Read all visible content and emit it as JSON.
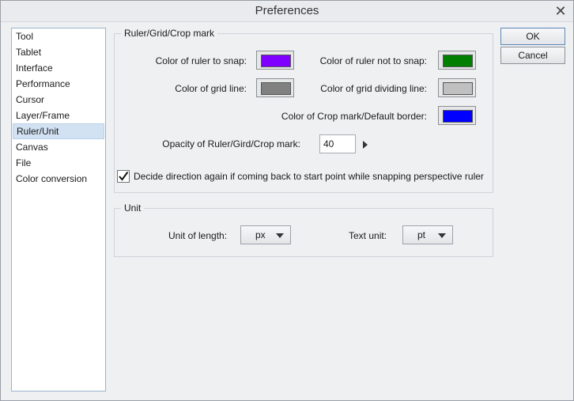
{
  "window": {
    "title": "Preferences",
    "close_glyph": "✕"
  },
  "sidebar": {
    "items": [
      {
        "label": "Tool"
      },
      {
        "label": "Tablet"
      },
      {
        "label": "Interface"
      },
      {
        "label": "Performance"
      },
      {
        "label": "Cursor"
      },
      {
        "label": "Layer/Frame"
      },
      {
        "label": "Ruler/Unit",
        "selected": true
      },
      {
        "label": "Canvas"
      },
      {
        "label": "File"
      },
      {
        "label": "Color conversion"
      }
    ]
  },
  "ruler_group": {
    "legend": "Ruler/Grid/Crop mark",
    "snap_label": "Color of ruler to snap:",
    "snap_color": "#7f00ff",
    "nosnap_label": "Color of ruler not to snap:",
    "nosnap_color": "#007f00",
    "grid_label": "Color of grid line:",
    "grid_color": "#808080",
    "griddiv_label": "Color of grid dividing line:",
    "griddiv_color": "#c0c0c0",
    "crop_label": "Color of Crop mark/Default border:",
    "crop_color": "#0000ff",
    "opacity_label": "Opacity of Ruler/Gird/Crop mark:",
    "opacity_value": "40",
    "perspective_label": "Decide direction again if coming back to start point while snapping perspective ruler",
    "perspective_checked": true
  },
  "unit_group": {
    "legend": "Unit",
    "length_label": "Unit of length:",
    "length_value": "px",
    "text_label": "Text unit:",
    "text_value": "pt"
  },
  "buttons": {
    "ok": "OK",
    "cancel": "Cancel"
  }
}
